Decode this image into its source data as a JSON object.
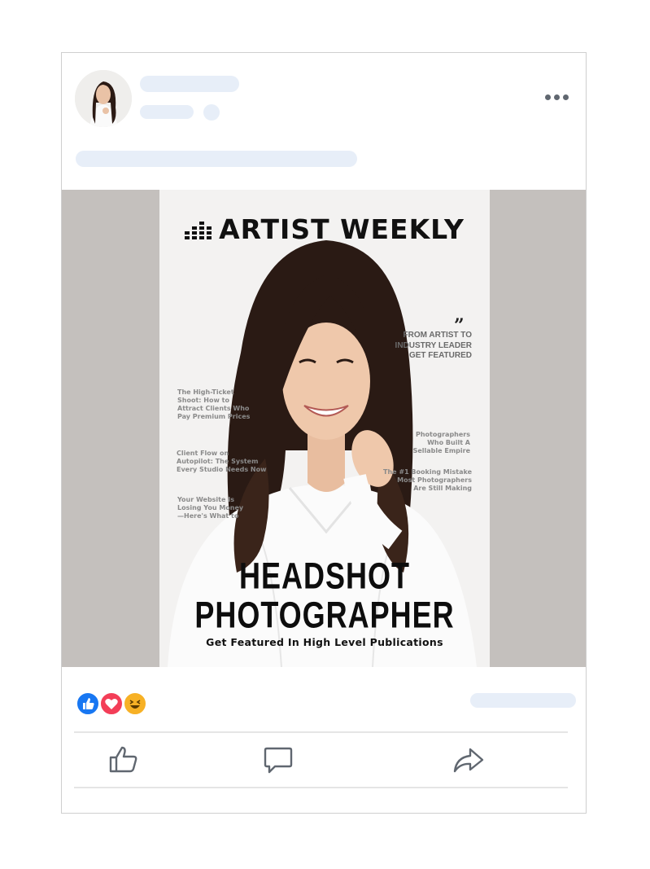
{
  "post": {
    "author_avatar": "avatar",
    "more_icon": "more-horizontal-icon"
  },
  "magazine": {
    "masthead": "ARTIST WEEKLY",
    "left_teasers": [
      "The High-Ticket\nShoot: How to\nAttract Clients Who\nPay Premium Prices",
      "Client Flow on\nAutopilot: The System\nEvery Studio Needs Now",
      "Your Website Is\nLosing You Money\n—Here's What to"
    ],
    "right_teasers": [
      "FROM ARTIST TO\nINDUSTRY LEADER\nGET FEATURED",
      "Photographers\nWho Built A\nSellable Empire",
      "The #1 Booking Mistake\nMost Photographers\nAre Still Making"
    ],
    "headline_1": "HEADSHOT",
    "headline_2": "PHOTOGRAPHER",
    "subheadline": "Get Featured In High Level Publications"
  },
  "reactions": {
    "icons": [
      "like-reaction-icon",
      "love-reaction-icon",
      "haha-reaction-icon"
    ],
    "colors": {
      "like": "#1877f2",
      "love": "#f33e58",
      "haha": "#f7b125"
    }
  },
  "actions": {
    "icons": [
      "like-icon",
      "comment-icon",
      "share-icon"
    ]
  },
  "colors": {
    "skeleton": "#e7eef8",
    "photo_background": "#c4c0bd",
    "card_border": "#cfcfcf"
  }
}
